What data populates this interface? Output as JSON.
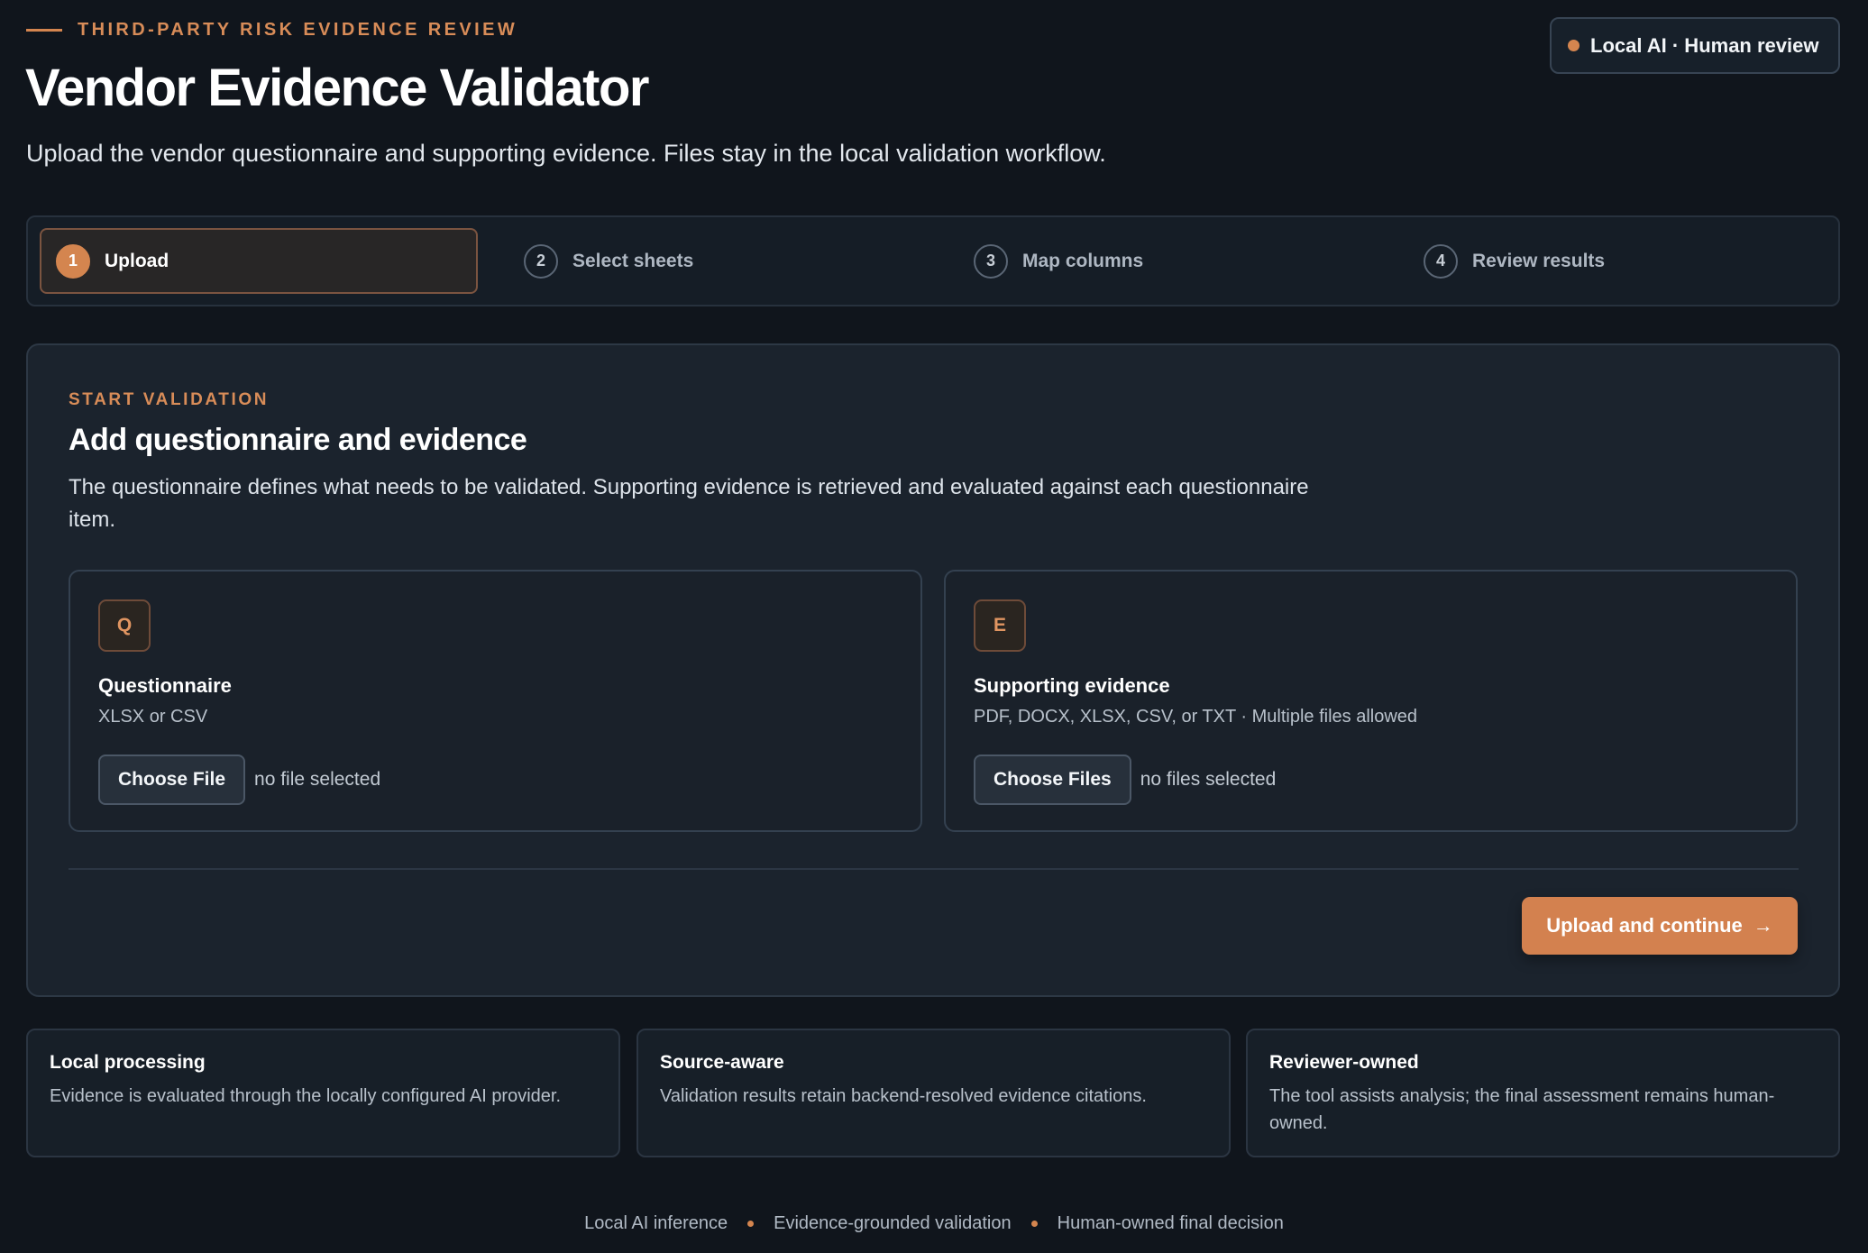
{
  "header": {
    "eyebrow": "THIRD-PARTY RISK EVIDENCE REVIEW",
    "title": "Vendor Evidence Validator",
    "subtitle": "Upload the vendor questionnaire and supporting evidence. Files stay in the local validation workflow.",
    "badge": "Local AI · Human review"
  },
  "steps": [
    {
      "num": "1",
      "label": "Upload",
      "active": true
    },
    {
      "num": "2",
      "label": "Select sheets",
      "active": false
    },
    {
      "num": "3",
      "label": "Map columns",
      "active": false
    },
    {
      "num": "4",
      "label": "Review results",
      "active": false
    }
  ],
  "main": {
    "eyebrow": "START VALIDATION",
    "title": "Add questionnaire and evidence",
    "description": "The questionnaire defines what needs to be validated. Supporting evidence is retrieved and evaluated against each questionnaire item.",
    "questionnaire": {
      "tile": "Q",
      "title": "Questionnaire",
      "formats": "XLSX or CSV",
      "button": "Choose File",
      "status": "no file selected"
    },
    "evidence": {
      "tile": "E",
      "title": "Supporting evidence",
      "formats": "PDF, DOCX, XLSX, CSV, or TXT · Multiple files allowed",
      "button": "Choose Files",
      "status": "no files selected"
    },
    "submit": "Upload and continue",
    "submit_arrow": "→"
  },
  "info_cards": [
    {
      "title": "Local processing",
      "text": "Evidence is evaluated through the locally configured AI provider."
    },
    {
      "title": "Source-aware",
      "text": "Validation results retain backend-resolved evidence citations."
    },
    {
      "title": "Reviewer-owned",
      "text": "The tool assists analysis; the final assessment remains human-owned."
    }
  ],
  "footer": [
    "Local AI inference",
    "Evidence-grounded validation",
    "Human-owned final decision"
  ],
  "colors": {
    "accent": "#d4854f",
    "background": "#10151c",
    "card": "#1b232d"
  }
}
